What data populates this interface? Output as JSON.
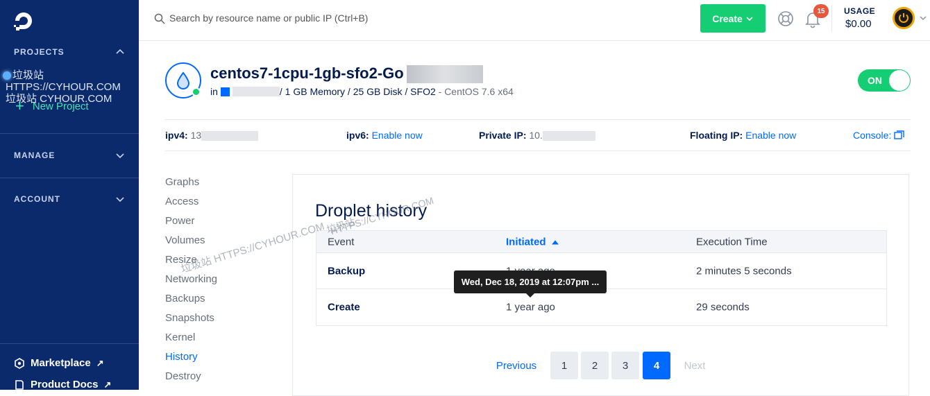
{
  "sidebar": {
    "projects_label": "PROJECTS",
    "new_project_label": "New Project",
    "manage_label": "MANAGE",
    "account_label": "ACCOUNT",
    "marketplace_label": "Marketplace",
    "product_docs_label": "Product Docs",
    "watermark_line1": "垃圾站 HTTPS://CYHOUR.COM",
    "watermark_line2": "垃圾站 CYHOUR.COM"
  },
  "header": {
    "search_placeholder": "Search by resource name or public IP (Ctrl+B)",
    "create_label": "Create",
    "notification_count": "15",
    "usage_label": "USAGE",
    "usage_value": "$0.00"
  },
  "droplet": {
    "name": "centos7-1cpu-1gb-sfo2-Go",
    "in_label": "in",
    "specs": "/ 1 GB Memory / 25 GB Disk / SFO2",
    "os": " - CentOS 7.6 x64",
    "power_label": "ON",
    "status_color": "#15cd72"
  },
  "ip_bar": {
    "ipv4_label": "ipv4:",
    "ipv4_value": "13",
    "ipv6_label": "ipv6:",
    "ipv6_link": "Enable now",
    "private_label": "Private IP:",
    "private_value": "10.",
    "floating_label": "Floating IP:",
    "floating_link": "Enable now",
    "console_label": "Console:"
  },
  "subnav": [
    "Graphs",
    "Access",
    "Power",
    "Volumes",
    "Resize",
    "Networking",
    "Backups",
    "Snapshots",
    "Kernel",
    "History",
    "Destroy"
  ],
  "subnav_active": "History",
  "history": {
    "title": "Droplet history",
    "columns": [
      "Event",
      "Initiated",
      "Execution Time"
    ],
    "rows": [
      {
        "event": "Backup",
        "initiated": "1 year ago",
        "execution": "2 minutes 5 seconds"
      },
      {
        "event": "Create",
        "initiated": "1 year ago",
        "execution": "29 seconds"
      }
    ],
    "tooltip": "Wed, Dec 18, 2019 at 12:07pm ..."
  },
  "pagination": {
    "previous": "Previous",
    "pages": [
      "1",
      "2",
      "3",
      "4"
    ],
    "current": "4",
    "next": "Next"
  },
  "watermarks": {
    "w1": "垃圾站 HTTPS://CYHOUR.COM",
    "w2": "HTTPS://CYHOUR.COM",
    "w3": "垃圾站"
  },
  "colors": {
    "sidebar": "#0b2a6b",
    "accent": "#0069ff",
    "create": "#15cd72"
  }
}
